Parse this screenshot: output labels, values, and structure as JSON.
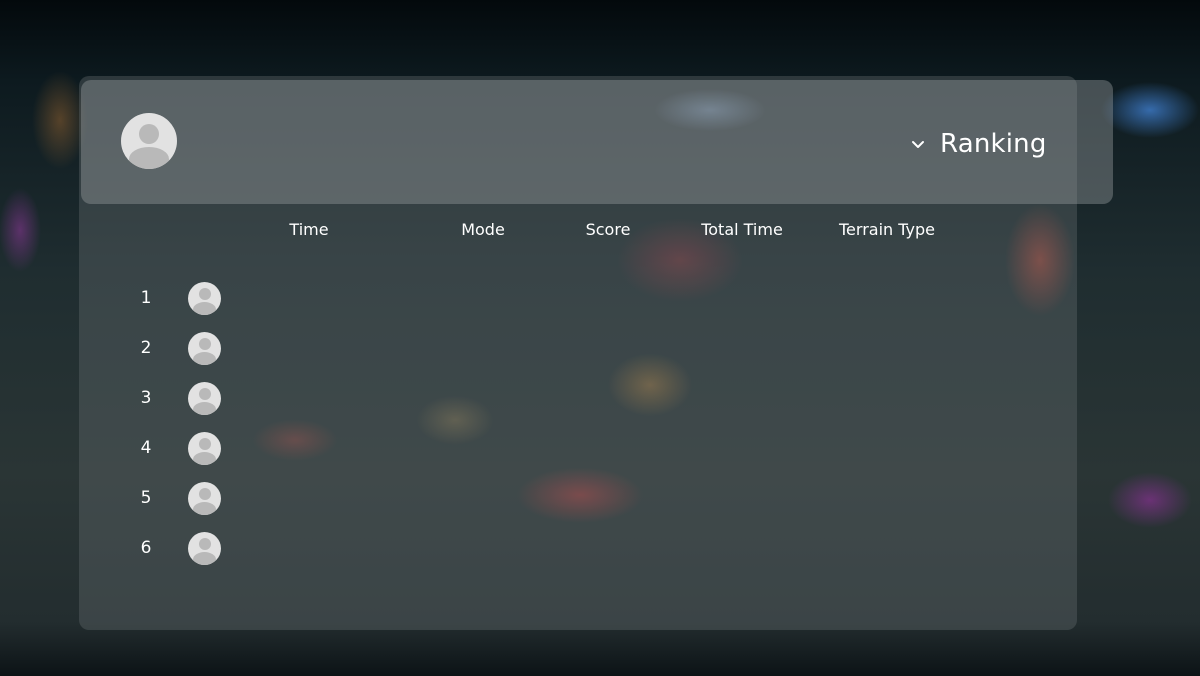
{
  "header": {
    "ranking_label": "Ranking",
    "ranking_icon": "chevron-down-icon"
  },
  "columns": [
    "Time",
    "Mode",
    "Score",
    "Total Time",
    "Terrain Type"
  ],
  "rows": [
    {
      "rank": "1"
    },
    {
      "rank": "2"
    },
    {
      "rank": "3"
    },
    {
      "rank": "4"
    },
    {
      "rank": "5"
    },
    {
      "rank": "6"
    }
  ],
  "colors": {
    "text": "#ffffff",
    "avatar_bg": "#e2e2e2",
    "avatar_fg": "#b9b9b9"
  }
}
